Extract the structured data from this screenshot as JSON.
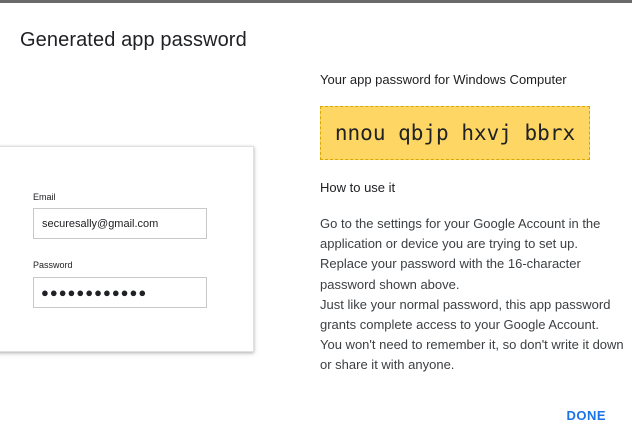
{
  "dialog": {
    "title": "Generated app password"
  },
  "preview": {
    "email_label": "Email",
    "email_value": "securesally@gmail.com",
    "password_label": "Password",
    "password_value": "●●●●●●●●●●●●"
  },
  "result": {
    "password_for": "Your app password for Windows Computer",
    "app_password": "nnou qbjp hxvj bbrx",
    "how_heading": "How to use it",
    "instructions_1": "Go to the settings for your Google Account in the application or device you are trying to set up. Replace your password with the 16-character password shown above.",
    "instructions_2": "Just like your normal password, this app password grants complete access to your Google Account. You won't need to remember it, so don't write it down or share it with anyone."
  },
  "actions": {
    "done_label": "DONE"
  },
  "colors": {
    "password_highlight": "#fdd663",
    "accent": "#1a73e8"
  }
}
